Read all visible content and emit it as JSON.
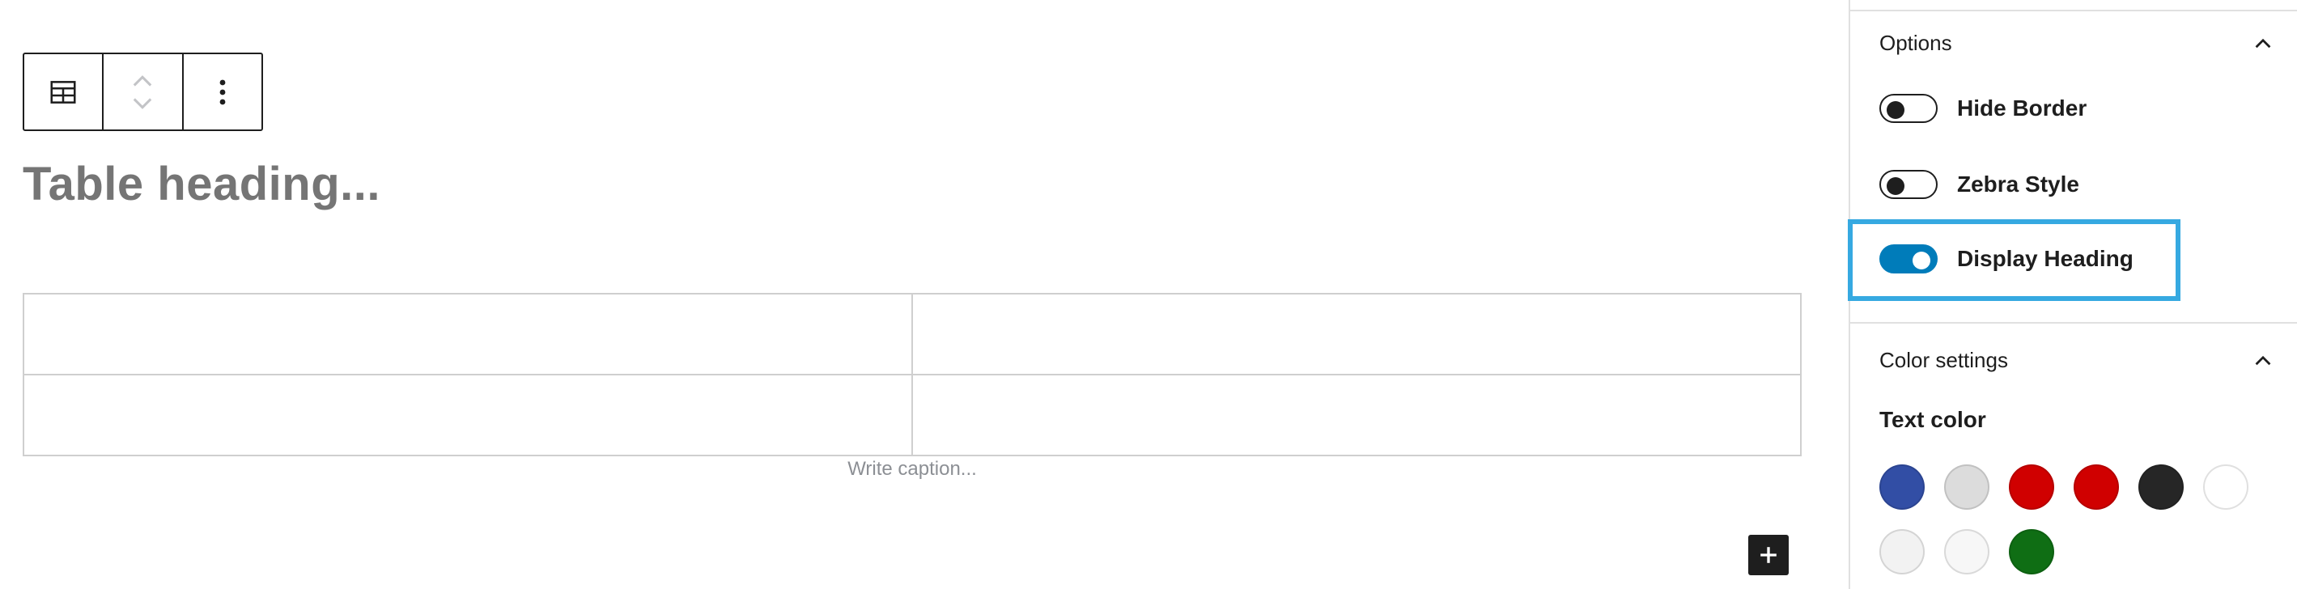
{
  "editor": {
    "toolbar": {
      "table_icon": "table-icon",
      "move_icon": "up-down-arrows-icon",
      "more_icon": "more-vertical-icon"
    },
    "heading_placeholder": "Table heading...",
    "caption_placeholder": "Write caption...",
    "add_block_icon": "plus-icon"
  },
  "sidebar": {
    "options_panel": {
      "title": "Options",
      "toggles": [
        {
          "label": "Hide Border",
          "checked": false
        },
        {
          "label": "Zebra Style",
          "checked": false
        },
        {
          "label": "Display Heading",
          "checked": true
        }
      ]
    },
    "color_panel": {
      "title": "Color settings",
      "text_color_label": "Text color",
      "swatches": [
        "#324ea5",
        "#dcdcdc",
        "#d00000",
        "#d00000",
        "#262626",
        "#ffffff",
        "#f2f2f2",
        "#f7f7f7",
        "#0f6e14"
      ]
    }
  },
  "colors": {
    "accent": "#007cba",
    "highlight": "#36a9e1"
  }
}
